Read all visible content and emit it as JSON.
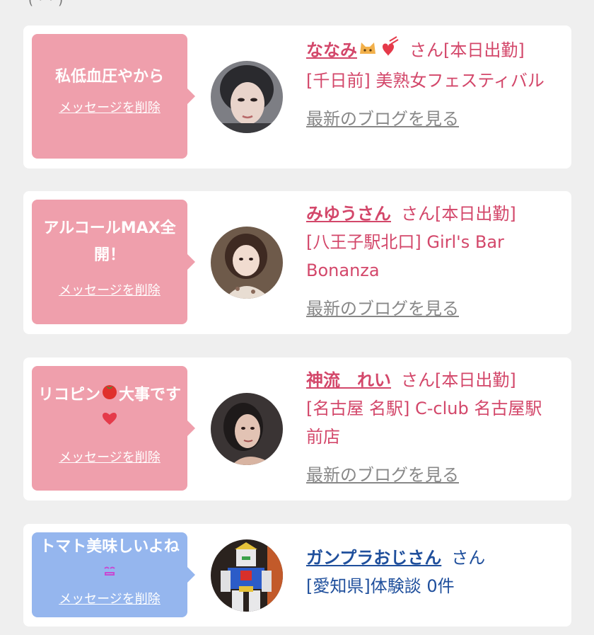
{
  "top_fragment": "( ･ ･ )",
  "cards": [
    {
      "bubble_text": "私低血圧やから",
      "delete_label": "メッセージを削除",
      "name": "ななみ",
      "suffix": "さん[本日出勤]",
      "shop": "[千日前] 美熟女フェスティバル",
      "blog_label": "最新のブログを見る",
      "avatar_icon": "woman-portrait-icon",
      "name_emoji_icon": "cat-heart-emoji-icon"
    },
    {
      "bubble_text": "アルコールMAX全開！",
      "delete_label": "メッセージを削除",
      "name": "みゆうさん",
      "suffix": "さん[本日出勤]",
      "shop": "[八王子駅北口] Girl's Bar Bonanza",
      "blog_label": "最新のブログを見る",
      "avatar_icon": "woman-portrait-icon"
    },
    {
      "bubble_text": "リコピン",
      "bubble_text_mid": "大事です",
      "delete_label": "メッセージを削除",
      "name": "神流　れい",
      "suffix": "さん[本日出勤]",
      "shop": "[名古屋 名駅] C-club 名古屋駅前店",
      "blog_label": "最新のブログを見る",
      "avatar_icon": "woman-portrait-icon",
      "bubble_emojis": [
        "tomato-emoji-icon",
        "heart-emoji-icon"
      ]
    },
    {
      "bubble_text": "トマト美味しいよね",
      "delete_label": "メッセージを削除",
      "name": "ガンプラおじさん",
      "suffix": "さん",
      "shop": "[愛知県]体験談 0件",
      "avatar_icon": "gundam-figure-icon",
      "bubble_emojis": [
        "smile-emoji-icon"
      ]
    }
  ],
  "colors": {
    "pink_bubble": "#ef9fac",
    "blue_bubble": "#95b6ee",
    "pink_text": "#d3476a",
    "blue_text": "#1f4f9c"
  }
}
